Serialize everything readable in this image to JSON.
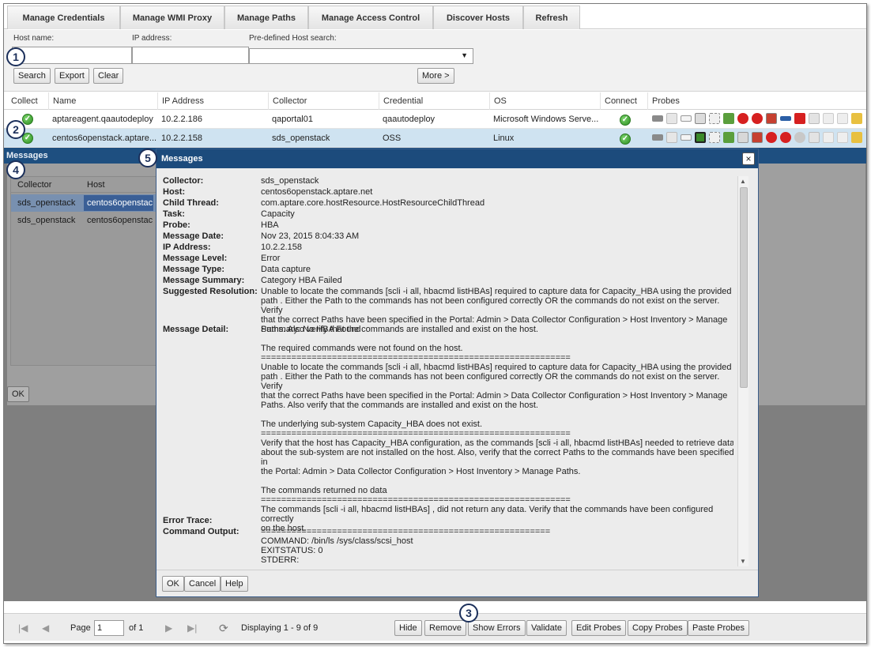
{
  "tabs": [
    "Manage Credentials",
    "Manage WMI Proxy",
    "Manage Paths",
    "Manage Access Control",
    "Discover Hosts",
    "Refresh"
  ],
  "search": {
    "host_name_label": "Host name:",
    "ip_address_label": "IP address:",
    "predefined_label": "Pre-defined Host search:",
    "host_name_value": "",
    "ip_address_value": "",
    "predefined_value": "",
    "search_button": "Search",
    "export_button": "Export",
    "clear_button": "Clear",
    "more_button": "More >"
  },
  "grid": {
    "columns": [
      "Collect",
      "Name",
      "IP Address",
      "Collector",
      "Credential",
      "OS",
      "Connect",
      "Probes"
    ],
    "rows": [
      {
        "name": "aptareagent.qaautodeploy",
        "ip": "10.2.2.186",
        "collector": "qaportal01",
        "credential": "qaautodeploy",
        "os": "Microsoft Windows Serve..."
      },
      {
        "name": "centos6openstack.aptare...",
        "ip": "10.2.2.158",
        "collector": "sds_openstack",
        "credential": "OSS",
        "os": "Linux"
      }
    ]
  },
  "callouts": [
    "1",
    "2",
    "3",
    "4",
    "5"
  ],
  "messages_panel": {
    "title": "Messages",
    "columns": [
      "Collector",
      "Host"
    ],
    "rows": [
      {
        "collector": "sds_openstack",
        "host": "centos6openstac"
      },
      {
        "collector": "sds_openstack",
        "host": "centos6openstac"
      }
    ],
    "ok_button": "OK"
  },
  "dialog": {
    "title": "Messages",
    "close_icon": "close-icon",
    "fields": [
      {
        "label": "Collector:",
        "value": "sds_openstack"
      },
      {
        "label": "Host:",
        "value": "centos6openstack.aptare.net"
      },
      {
        "label": "Child Thread:",
        "value": "com.aptare.core.hostResource.HostResourceChildThread"
      },
      {
        "label": "Task:",
        "value": "Capacity"
      },
      {
        "label": "Probe:",
        "value": "HBA"
      },
      {
        "label": "Message Date:",
        "value": "Nov 23, 2015 8:04:33 AM"
      },
      {
        "label": "IP Address:",
        "value": "10.2.2.158"
      },
      {
        "label": "Message Level:",
        "value": "Error"
      },
      {
        "label": "Message Type:",
        "value": "Data capture"
      },
      {
        "label": "Message Summary:",
        "value": "Category HBA Failed"
      },
      {
        "label": "Suggested Resolution:",
        "value": "Unable to locate the commands [scli -i all, hbacmd listHBAs] required to capture data for Capacity_HBA using the provided\npath . Either the Path to the commands has not been configured correctly OR the commands do not exist on the server. Verify\nthat the correct Paths have been specified in the Portal: Admin > Data Collector Configuration > Host Inventory > Manage\nPaths. Also verify that the commands are installed and exist on the host."
      },
      {
        "label": "Message Detail:",
        "value": "Summary: No HBA Found\n\nThe required commands were not found on the host.\n=============================================================\nUnable to locate the commands [scli -i all, hbacmd listHBAs] required to capture data for Capacity_HBA using the provided\npath . Either the Path to the commands has not been configured correctly OR the commands do not exist on the server. Verify\nthat the correct Paths have been specified in the Portal: Admin > Data Collector Configuration > Host Inventory > Manage\nPaths. Also verify that the commands are installed and exist on the host.\n\nThe underlying sub-system Capacity_HBA does not exist.\n=============================================================\nVerify that the host has Capacity_HBA configuration, as the commands [scli -i all, hbacmd listHBAs] needed to retrieve data\nabout the sub-system are not installed on the host. Also, verify that the correct Paths to the commands have been specified in\nthe Portal: Admin > Data Collector Configuration > Host Inventory > Manage Paths.\n\nThe commands returned no data\n=============================================================\nThe commands [scli -i all, hbacmd listHBAs] , did not return any data. Verify that the commands have been configured correctly\non the host."
      },
      {
        "label": "Error Trace:",
        "value": ""
      },
      {
        "label": "Command Output:",
        "value": "=========================================================\nCOMMAND: /bin/ls /sys/class/scsi_host\nEXITSTATUS: 0\nSTDERR:"
      }
    ],
    "ok_button": "OK",
    "cancel_button": "Cancel",
    "help_button": "Help"
  },
  "pager": {
    "page_label": "Page",
    "page_value": "1",
    "of_label": "of 1",
    "displaying": "Displaying 1 - 9 of 9"
  },
  "actions": [
    "Hide",
    "Remove",
    "Show Errors",
    "Validate",
    "Edit Probes",
    "Copy Probes",
    "Paste Probes"
  ],
  "colors": {
    "header_blue": "#1c4b7c",
    "row_selected": "#cfe3f1",
    "connect_green": "#2d8f22",
    "error_red": "#d62020"
  }
}
